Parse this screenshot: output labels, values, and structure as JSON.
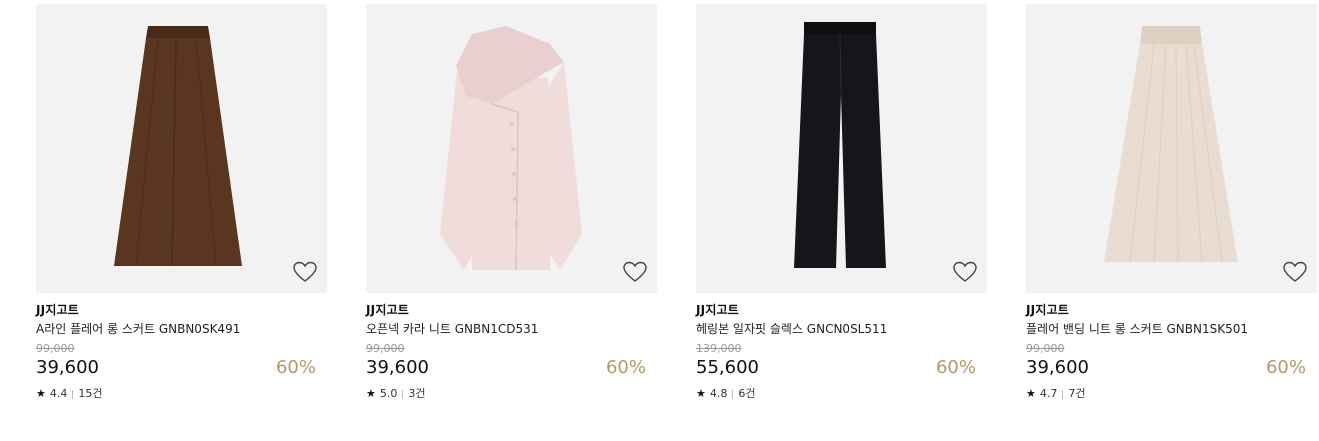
{
  "products": [
    {
      "brand": "JJ지고트",
      "name": "A라인 플레어 롱 스커트 GNBN0SK491",
      "original_price": "99,000",
      "price": "39,600",
      "discount": "60%",
      "rating": "4.4",
      "reviews": "15건",
      "image": "brown-flare-skirt",
      "color": "#5a3520"
    },
    {
      "brand": "JJ지고트",
      "name": "오픈넥 카라 니트 GNBN1CD531",
      "original_price": "99,000",
      "price": "39,600",
      "discount": "60%",
      "rating": "5.0",
      "reviews": "3건",
      "image": "pink-collar-knit",
      "color": "#f1dcdc"
    },
    {
      "brand": "JJ지고트",
      "name": "헤링본 일자핏 슬렉스 GNCN0SL511",
      "original_price": "139,000",
      "price": "55,600",
      "discount": "60%",
      "rating": "4.8",
      "reviews": "6건",
      "image": "black-straight-slacks",
      "color": "#15161a"
    },
    {
      "brand": "JJ지고트",
      "name": "플레어 밴딩 니트 롱 스커트 GNBN1SK501",
      "original_price": "99,000",
      "price": "39,600",
      "discount": "60%",
      "rating": "4.7",
      "reviews": "7건",
      "image": "beige-knit-skirt",
      "color": "#e8ddd0"
    }
  ],
  "icons": {
    "wishlist": "heart-outline-icon",
    "rating": "star-icon"
  },
  "colors": {
    "discount": "#b39966",
    "original_price": "#999999",
    "thumb_bg": "#f2f2f2"
  }
}
